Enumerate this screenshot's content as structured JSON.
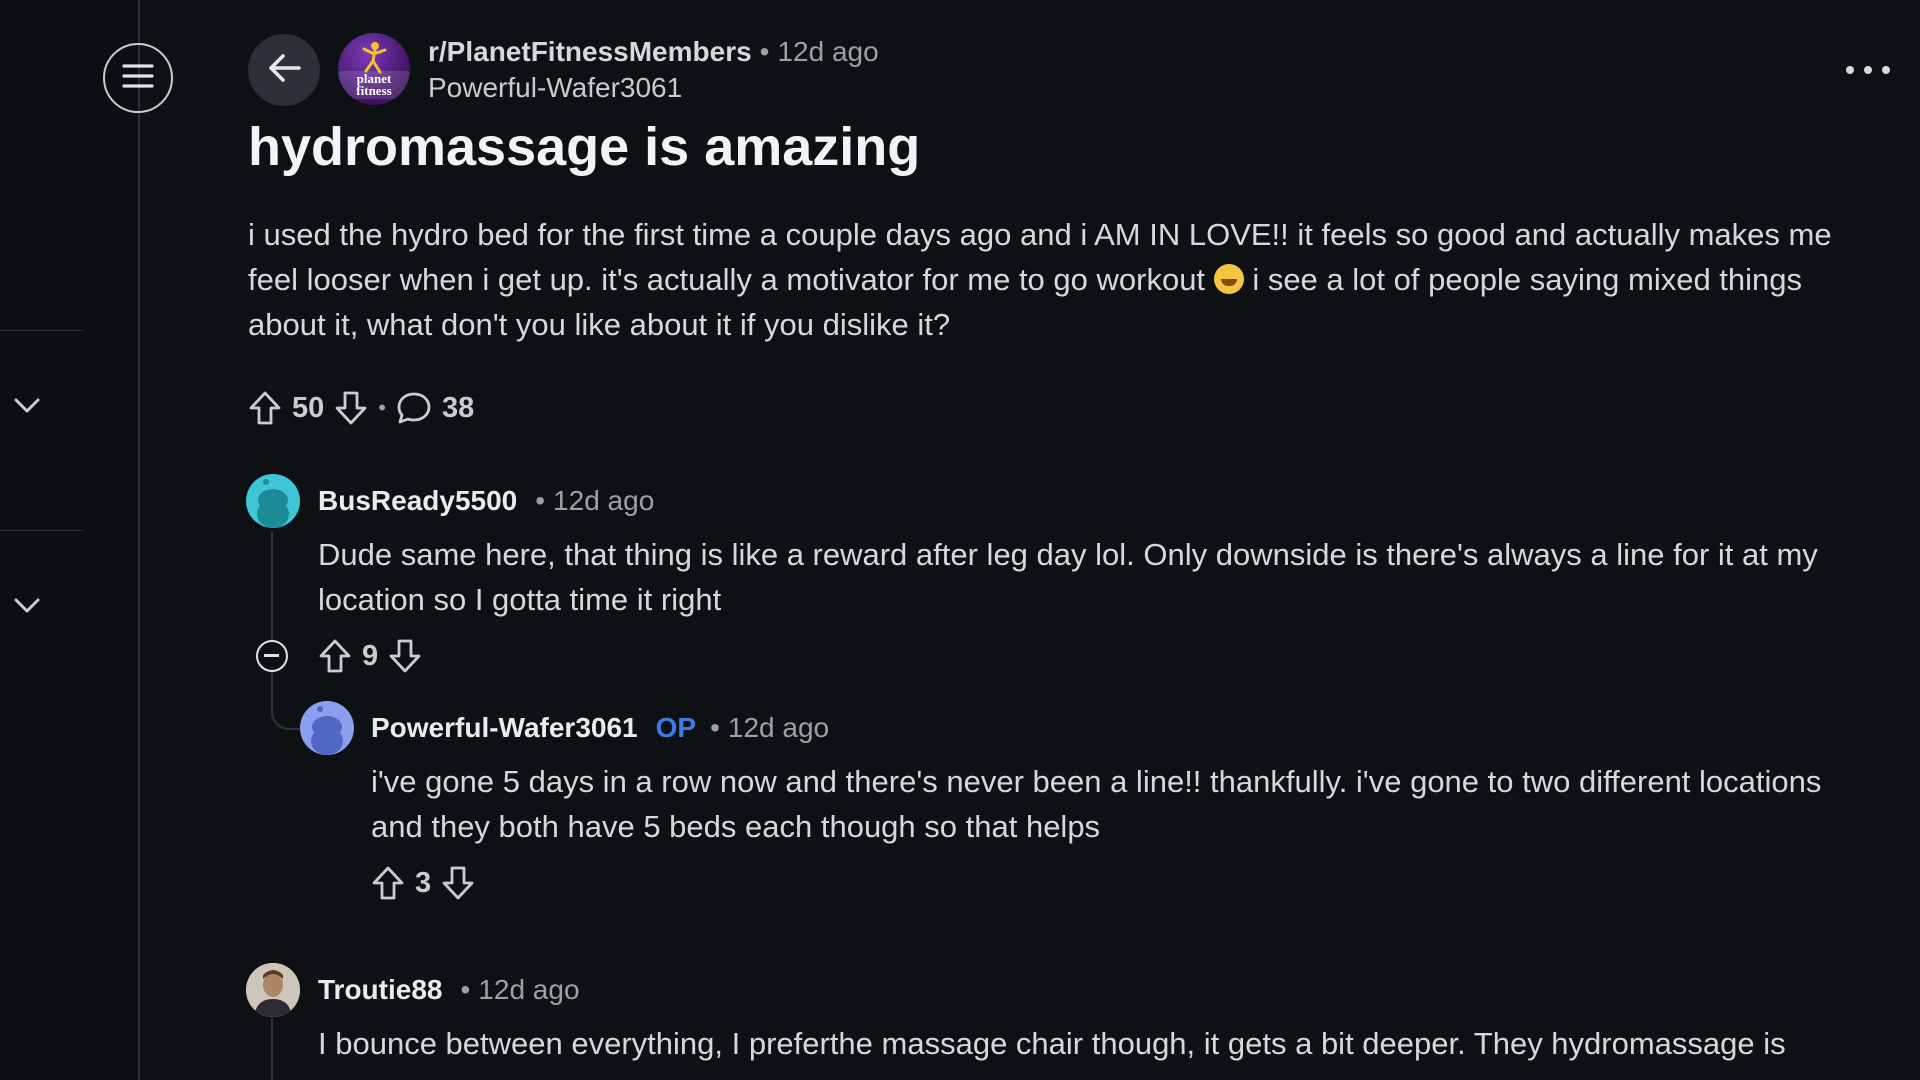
{
  "post": {
    "subreddit": "r/PlanetFitnessMembers",
    "subreddit_logo_text": "planet fitness",
    "time": "12d ago",
    "author": "Powerful-Wafer3061",
    "title": "hydromassage is amazing",
    "body_part1": "i used the hydro bed for the first time a couple days ago and i AM IN LOVE!! it feels so good and actually makes me feel looser when i get up. it's actually a motivator for me to go workout",
    "body_emoji": "rolling-on-floor-laughing-emoji",
    "body_part2": "i see a lot of people saying mixed things about it, what don't you like about it if you dislike it?",
    "upvotes": "50",
    "comments": "38"
  },
  "icons": {
    "menu": "hamburger-menu-icon",
    "back": "back-arrow-icon",
    "more": "more-options-icon",
    "upvote": "upvote-arrow-icon",
    "downvote": "downvote-arrow-icon",
    "comment": "comment-bubble-icon",
    "collapse": "collapse-thread-icon",
    "rail_chevron": "chevron-down-icon"
  },
  "separator": "•",
  "comments": [
    {
      "user": "BusReady5500",
      "time": "12d ago",
      "body": "Dude same here, that thing is like a reward after leg day lol. Only downside is there's always a line for it at my location so I gotta time it right",
      "votes": "9",
      "avatar_color": "#3ec6d6"
    },
    {
      "user": "Powerful-Wafer3061",
      "op_label": "OP",
      "time": "12d ago",
      "body": "i've gone 5 days in a row now and there's never been a line!! thankfully. i've gone to two different locations and they both have 5 beds each though so that helps",
      "votes": "3",
      "avatar_color": "#8a9ff0"
    },
    {
      "user": "Troutie88",
      "time": "12d ago",
      "body": "I bounce between everything, I preferthe massage chair though, it gets a bit deeper. They hydromassage is"
    }
  ],
  "colors": {
    "background": "#0d1114",
    "op_accent": "#3e7be6",
    "subreddit_avatar": "#5a1f8f"
  }
}
